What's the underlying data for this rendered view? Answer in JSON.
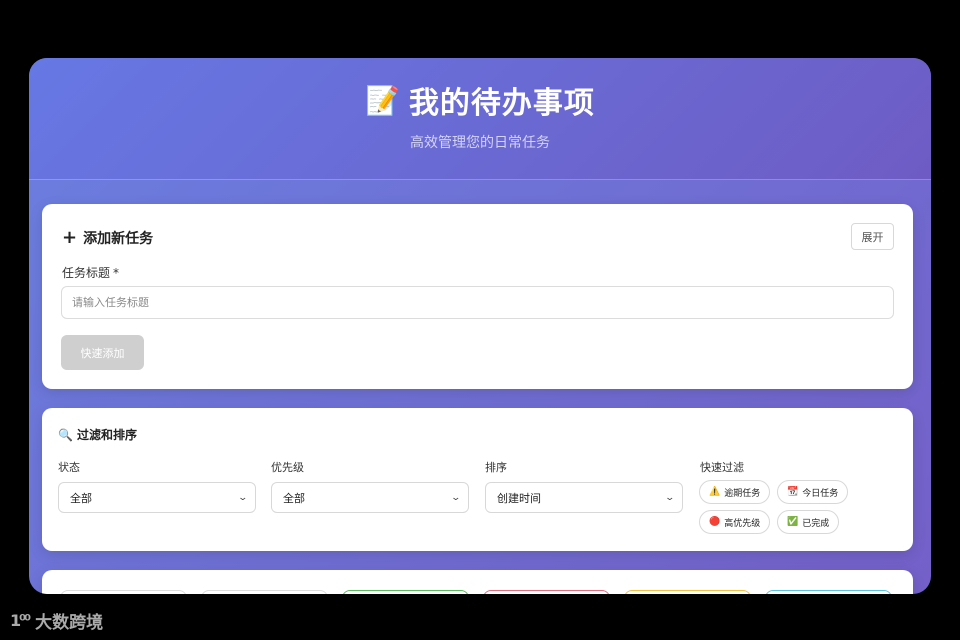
{
  "header": {
    "icon": "📝",
    "title": "我的待办事项",
    "subtitle": "高效管理您的日常任务"
  },
  "add_task": {
    "heading": "添加新任务",
    "expand_label": "展开",
    "title_label": "任务标题",
    "required_mark": "*",
    "title_placeholder": "请输入任务标题",
    "title_value": "",
    "quick_add_label": "快速添加"
  },
  "filter": {
    "heading": "过滤和排序",
    "status": {
      "label": "状态",
      "selected": "全部"
    },
    "priority": {
      "label": "优先级",
      "selected": "全部"
    },
    "sort": {
      "label": "排序",
      "selected": "创建时间"
    },
    "quick_filter_label": "快速过滤",
    "chips": [
      {
        "emoji": "⚠️",
        "label": "逾期任务"
      },
      {
        "emoji": "📆",
        "label": "今日任务"
      },
      {
        "emoji": "🔴",
        "label": "高优先级"
      },
      {
        "emoji": "✅",
        "label": "已完成"
      }
    ]
  },
  "stats_tab_colors": [
    "#dcdcdc",
    "#dcdcdc",
    "#5cb85c",
    "#e06b7d",
    "#f0c040",
    "#5bc0de"
  ],
  "watermark": {
    "text": "大数跨境",
    "logo": "1⁰⁰"
  }
}
